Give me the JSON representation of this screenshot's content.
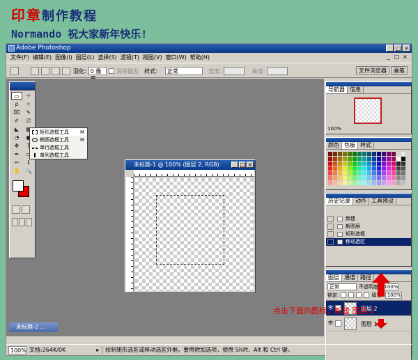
{
  "banner": {
    "title_red": "印章",
    "title_blue": "制作教程",
    "subtitle": "Normando 祝大家新年快乐!"
  },
  "app": {
    "title": "Adobe Photoshop",
    "menu": [
      "文件(F)",
      "编辑(E)",
      "图像(I)",
      "图层(L)",
      "选择(S)",
      "滤镜(T)",
      "视图(V)",
      "窗口(W)",
      "帮助(H)"
    ],
    "window_buttons": [
      "_",
      "□",
      "×"
    ],
    "mdi_buttons": [
      "_",
      "□",
      "×"
    ]
  },
  "options": {
    "feather_label": "羽化:",
    "feather_value": "0 像素",
    "antialias_label": "消除锯齿",
    "style_label": "样式:",
    "style_value": "正常",
    "width_label": "宽度:",
    "height_label": "高度:",
    "well_tabs": [
      "文件浏览器",
      "画笔"
    ]
  },
  "toolbox": {
    "tools": [
      "▭",
      "⊹",
      "ρ",
      "✧",
      "⌧",
      "✎",
      "✐",
      "⎚",
      "◣",
      "▦",
      "◔",
      "●",
      "✥",
      "T",
      "✒",
      "▭",
      "✏",
      "ℹ",
      "✋",
      "🔍"
    ]
  },
  "flyout": {
    "items": [
      {
        "label": "矩形选框工具",
        "key": "M"
      },
      {
        "label": "椭圆选框工具",
        "key": "M"
      },
      {
        "label": "单行选框工具",
        "key": ""
      },
      {
        "label": "单列选框工具",
        "key": ""
      }
    ]
  },
  "document": {
    "title": "未标题-1 @ 100% (图层 2, RGB)"
  },
  "minidoc": {
    "title": "未标题-2 ..."
  },
  "status": {
    "zoom": "100%",
    "doc": "文档:264K/0K",
    "hint": "绘制矩形选区或移动选区外框。要用附加选项，使用 Shift、Alt 和 Ctrl 键。"
  },
  "navigator": {
    "tabs": [
      "导航器",
      "信息"
    ],
    "zoom": "100%"
  },
  "color_panel": {
    "tabs": [
      "颜色",
      "色板",
      "样式"
    ]
  },
  "history": {
    "tabs": [
      "历史记录",
      "动作",
      "工具预设"
    ],
    "items": [
      "新建",
      "新图层",
      "矩形选框",
      "移动选区"
    ]
  },
  "layers": {
    "tabs": [
      "图层",
      "通道",
      "路径"
    ],
    "blend": "正常",
    "opacity_label": "不透明度:",
    "opacity": "100%",
    "lock_label": "锁定:",
    "fill_label": "填充:",
    "fill": "100%",
    "rows": [
      "图层 2",
      "图层 1"
    ]
  },
  "annotation": {
    "text": "点击下面的图标，新建 图层 2"
  },
  "colors": {
    "accent_red": "#e00000",
    "title_blue": "#1b2f7a",
    "selection_navy": "#0a246a"
  }
}
